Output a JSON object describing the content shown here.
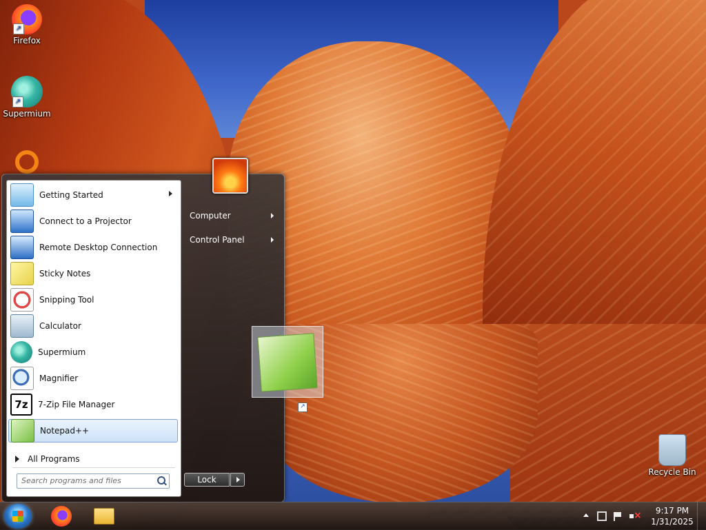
{
  "desktop": {
    "icons": [
      {
        "label": "Firefox",
        "icon": "firefox-icon"
      },
      {
        "label": "Supermium",
        "icon": "supermium-icon"
      },
      {
        "label": "",
        "icon": "orange-ring-app-icon"
      },
      {
        "label": "Recycle Bin",
        "icon": "recycle-bin-icon"
      }
    ]
  },
  "start_menu": {
    "programs": [
      {
        "label": "Getting Started",
        "icon": "getting-started-icon",
        "has_submenu": true
      },
      {
        "label": "Connect to a Projector",
        "icon": "projector-icon"
      },
      {
        "label": "Remote Desktop Connection",
        "icon": "remote-desktop-icon"
      },
      {
        "label": "Sticky Notes",
        "icon": "sticky-notes-icon"
      },
      {
        "label": "Snipping Tool",
        "icon": "snipping-tool-icon"
      },
      {
        "label": "Calculator",
        "icon": "calculator-icon"
      },
      {
        "label": "Supermium",
        "icon": "supermium-icon"
      },
      {
        "label": "Magnifier",
        "icon": "magnifier-icon"
      },
      {
        "label": "7-Zip File Manager",
        "icon": "7zip-icon",
        "icon_text": "7z"
      },
      {
        "label": "Notepad++",
        "icon": "notepad-plus-plus-icon",
        "selected": true
      }
    ],
    "all_programs": "All Programs",
    "search_placeholder": "Search programs and files",
    "right_items": [
      {
        "label": "Computer"
      },
      {
        "label": "Control Panel"
      }
    ],
    "lock_label": "Lock"
  },
  "drag_preview": {
    "icon": "notepad-plus-plus-icon"
  },
  "taskbar": {
    "pinned": [
      {
        "icon": "firefox-icon"
      },
      {
        "icon": "file-explorer-icon"
      }
    ],
    "time": "9:17 PM",
    "date": "1/31/2025"
  }
}
